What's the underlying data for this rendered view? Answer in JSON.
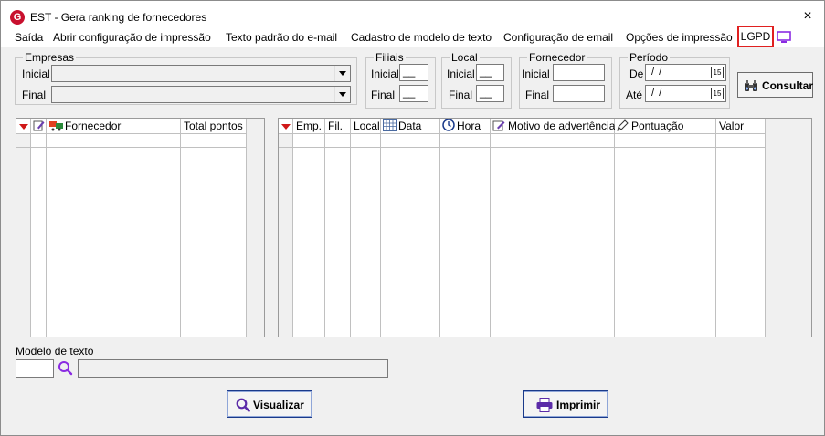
{
  "window": {
    "title": "EST - Gera ranking de fornecedores",
    "close": "×",
    "logo": "G"
  },
  "menu": {
    "items": [
      "Saída",
      "Abrir configuração de impressão",
      "Texto padrão do e-mail",
      "Cadastro de modelo de texto",
      "Configuração de email",
      "Opções de impressão"
    ],
    "lgpd": "LGPD"
  },
  "filters": {
    "empresas": {
      "title": "Empresas",
      "inicial_label": "Inicial",
      "final_label": "Final"
    },
    "filiais": {
      "title": "Filiais",
      "inicial_label": "Inicial",
      "final_label": "Final"
    },
    "local": {
      "title": "Local",
      "inicial_label": "Inicial",
      "final_label": "Final"
    },
    "fornecedor": {
      "title": "Fornecedor",
      "inicial_label": "Inicial",
      "final_label": "Final"
    },
    "periodo": {
      "title": "Período",
      "de_label": "De",
      "ate_label": "Até",
      "de_value": "/ /",
      "ate_value": "/ /",
      "cal": "15"
    },
    "mask": "__"
  },
  "consultar_button": "Consultar",
  "grid_left": {
    "columns": [
      "Fornecedor",
      "Total pontos"
    ]
  },
  "grid_right": {
    "columns": [
      "Emp.",
      "Fil.",
      "Local",
      "Data",
      "Hora",
      "Motivo de advertência",
      "Pontuação",
      "Valor"
    ]
  },
  "modelo_texto": {
    "label": "Modelo de texto"
  },
  "buttons": {
    "visualizar": "Visualizar",
    "imprimir": "Imprimir"
  },
  "colors": {
    "accent": "#8a2be2",
    "lgpd_border": "#e02020",
    "sort_arrow": "#d01818"
  }
}
